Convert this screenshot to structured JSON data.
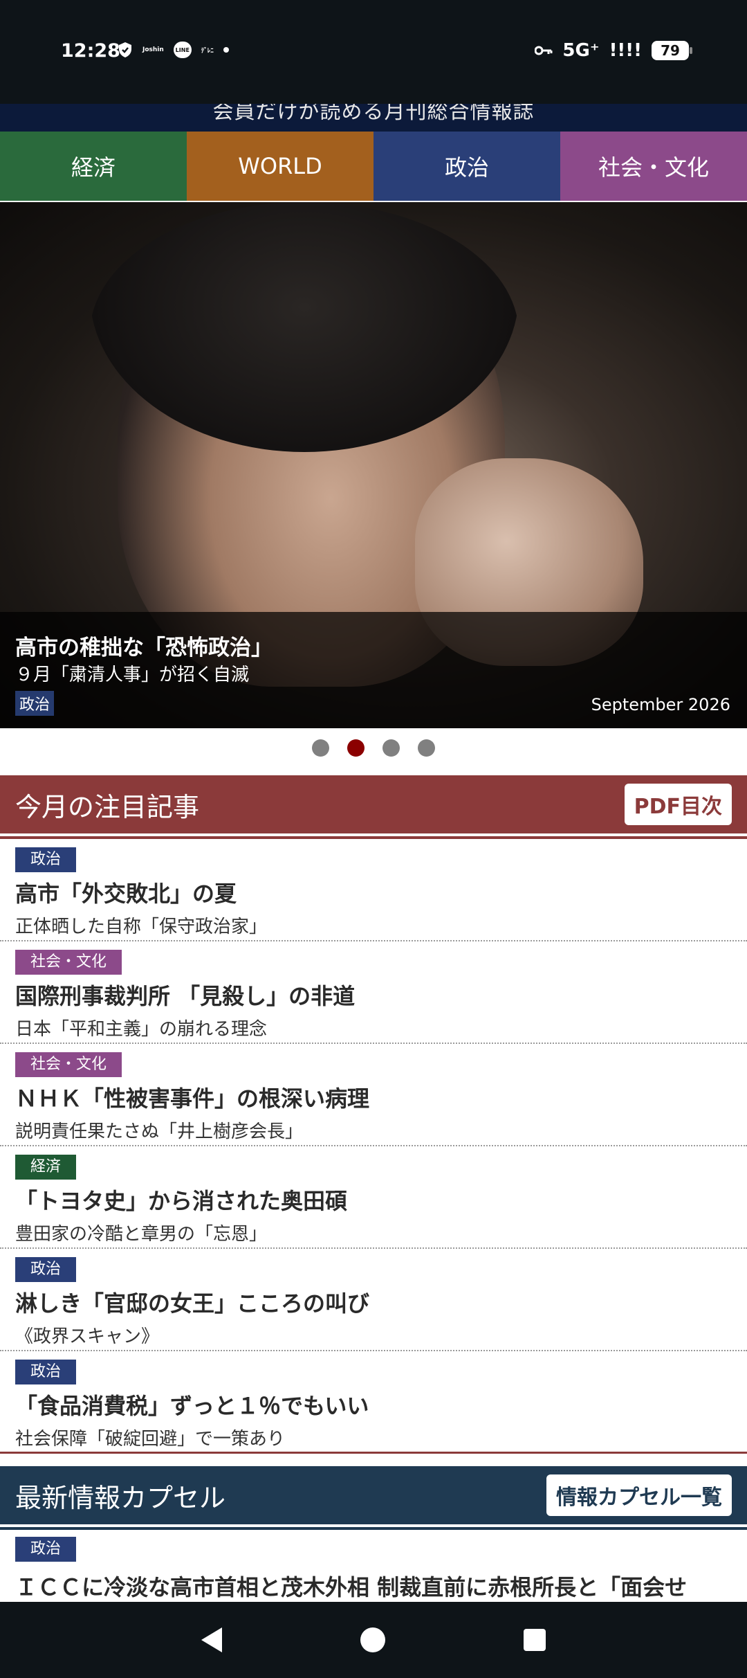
{
  "status_bar": {
    "time": "12:28",
    "left_icons": [
      "shield-icon",
      "joshin-icon",
      "line-icon",
      "app-icon"
    ],
    "left_icon_labels": [
      "Joshin",
      "LINE",
      "ﾃﾞﾚﾆ"
    ],
    "network": "5G⁺",
    "signal": "!!!!",
    "battery": "79"
  },
  "header": {
    "tagline": "会員だけが読める月刊総合情報誌"
  },
  "categories": [
    {
      "label": "経済",
      "color": "#2a6a3c"
    },
    {
      "label": "WORLD",
      "color": "#a3601e"
    },
    {
      "label": "政治",
      "color": "#2a3f78"
    },
    {
      "label": "社会・文化",
      "color": "#8c4a8a"
    }
  ],
  "hero": {
    "title": "高市の稚拙な「恐怖政治」",
    "subtitle": "９月「粛清人事」が招く自滅",
    "tag": "政治",
    "date": "September 2026"
  },
  "carousel": {
    "count": 4,
    "active_index": 1
  },
  "featured": {
    "title": "今月の注目記事",
    "button": "PDF目次",
    "color": "#8b3a3a",
    "articles": [
      {
        "category": "政治",
        "color": "#2a3f78",
        "title": "高市「外交敗北」の夏",
        "subtitle": "正体晒した自称「保守政治家」"
      },
      {
        "category": "社会・文化",
        "color": "#8c4a8a",
        "title": "国際刑事裁判所 「見殺し」の非道",
        "subtitle": "日本「平和主義」の崩れる理念"
      },
      {
        "category": "社会・文化",
        "color": "#8c4a8a",
        "title": "ＮＨＫ「性被害事件」の根深い病理",
        "subtitle": "説明責任果たさぬ「井上樹彦会長」"
      },
      {
        "category": "経済",
        "color": "#1f5a34",
        "title": "「トヨタ史」から消された奥田碩",
        "subtitle": "豊田家の冷酷と章男の「忘恩」"
      },
      {
        "category": "政治",
        "color": "#2a3f78",
        "title": "淋しき「官邸の女王」こころの叫び",
        "subtitle": "《政界スキャン》"
      },
      {
        "category": "政治",
        "color": "#2a3f78",
        "title": "「食品消費税」ずっと１％でもいい",
        "subtitle": "社会保障「破綻回避」で一策あり"
      }
    ]
  },
  "capsule": {
    "title": "最新情報カプセル",
    "button": "情報カプセル一覧",
    "color": "#1f3a52",
    "item": {
      "category": "政治",
      "color": "#2a3f78",
      "title": "ＩＣＣに冷淡な高市首相と茂木外相 制裁直前に赤根所長と「面会せ"
    }
  },
  "nav_bar": {
    "icons": [
      "back-icon",
      "home-icon",
      "recents-icon"
    ]
  }
}
